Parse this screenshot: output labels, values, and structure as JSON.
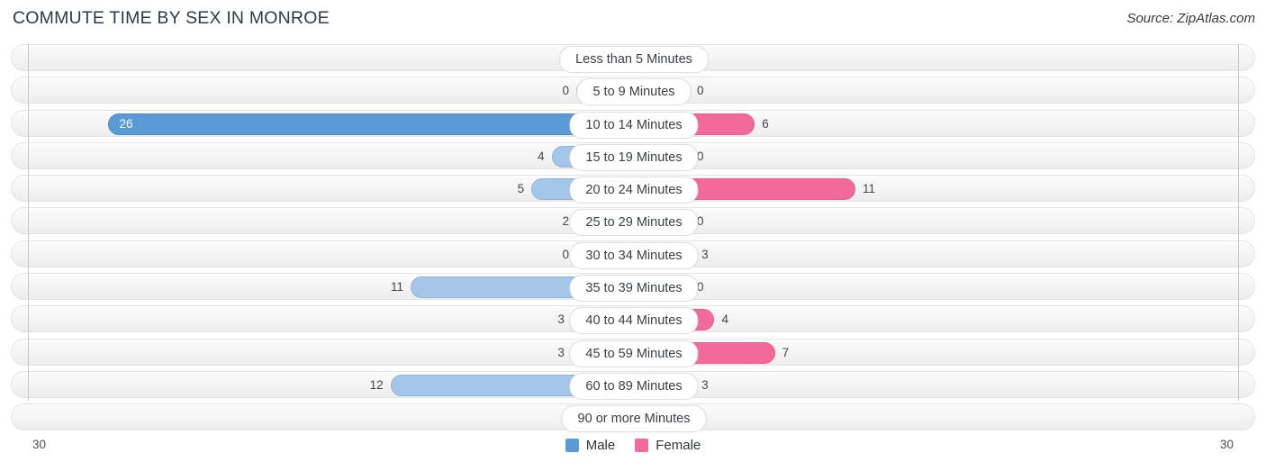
{
  "header": {
    "title": "COMMUTE TIME BY SEX IN MONROE",
    "source": "Source: ZipAtlas.com"
  },
  "legend": {
    "male_label": "Male",
    "female_label": "Female",
    "male_color": "#5b9bd5",
    "female_color": "#f4699b"
  },
  "axis": {
    "left_end": "30",
    "right_end": "30"
  },
  "chart_data": {
    "type": "bar",
    "title": "COMMUTE TIME BY SEX IN MONROE",
    "subtitle": "Source: ZipAtlas.com",
    "orientation": "horizontal-diverging",
    "xlabel": "",
    "ylabel": "",
    "xlim": [
      30,
      30
    ],
    "axis_max": 30,
    "grid": false,
    "legend_position": "bottom-center",
    "categories": [
      "Less than 5 Minutes",
      "5 to 9 Minutes",
      "10 to 14 Minutes",
      "15 to 19 Minutes",
      "20 to 24 Minutes",
      "25 to 29 Minutes",
      "30 to 34 Minutes",
      "35 to 39 Minutes",
      "40 to 44 Minutes",
      "45 to 59 Minutes",
      "60 to 89 Minutes",
      "90 or more Minutes"
    ],
    "series": [
      {
        "name": "Male",
        "values": [
          0,
          0,
          26,
          4,
          5,
          2,
          0,
          11,
          3,
          3,
          12,
          0
        ]
      },
      {
        "name": "Female",
        "values": [
          0,
          0,
          6,
          0,
          11,
          0,
          3,
          0,
          4,
          7,
          3,
          0
        ]
      }
    ],
    "rows": [
      {
        "label": "Less than 5 Minutes",
        "male": 0,
        "male_text": "0",
        "female": 0,
        "female_text": "0",
        "male_hi": false,
        "female_hi": false,
        "male_inside": false
      },
      {
        "label": "5 to 9 Minutes",
        "male": 0,
        "male_text": "0",
        "female": 0,
        "female_text": "0",
        "male_hi": false,
        "female_hi": false,
        "male_inside": false
      },
      {
        "label": "10 to 14 Minutes",
        "male": 26,
        "male_text": "26",
        "female": 6,
        "female_text": "6",
        "male_hi": true,
        "female_hi": true,
        "male_inside": true
      },
      {
        "label": "15 to 19 Minutes",
        "male": 4,
        "male_text": "4",
        "female": 0,
        "female_text": "0",
        "male_hi": false,
        "female_hi": false,
        "male_inside": false
      },
      {
        "label": "20 to 24 Minutes",
        "male": 5,
        "male_text": "5",
        "female": 11,
        "female_text": "11",
        "male_hi": false,
        "female_hi": true,
        "male_inside": false
      },
      {
        "label": "25 to 29 Minutes",
        "male": 2,
        "male_text": "2",
        "female": 0,
        "female_text": "0",
        "male_hi": false,
        "female_hi": false,
        "male_inside": false
      },
      {
        "label": "30 to 34 Minutes",
        "male": 0,
        "male_text": "0",
        "female": 3,
        "female_text": "3",
        "male_hi": false,
        "female_hi": true,
        "male_inside": false
      },
      {
        "label": "35 to 39 Minutes",
        "male": 11,
        "male_text": "11",
        "female": 0,
        "female_text": "0",
        "male_hi": false,
        "female_hi": false,
        "male_inside": false
      },
      {
        "label": "40 to 44 Minutes",
        "male": 3,
        "male_text": "3",
        "female": 4,
        "female_text": "4",
        "male_hi": false,
        "female_hi": true,
        "male_inside": false
      },
      {
        "label": "45 to 59 Minutes",
        "male": 3,
        "male_text": "3",
        "female": 7,
        "female_text": "7",
        "male_hi": false,
        "female_hi": true,
        "male_inside": false
      },
      {
        "label": "60 to 89 Minutes",
        "male": 12,
        "male_text": "12",
        "female": 3,
        "female_text": "3",
        "male_hi": false,
        "female_hi": true,
        "male_inside": false
      },
      {
        "label": "90 or more Minutes",
        "male": 0,
        "male_text": "0",
        "female": 0,
        "female_text": "0",
        "male_hi": false,
        "female_hi": false,
        "male_inside": false
      }
    ]
  }
}
